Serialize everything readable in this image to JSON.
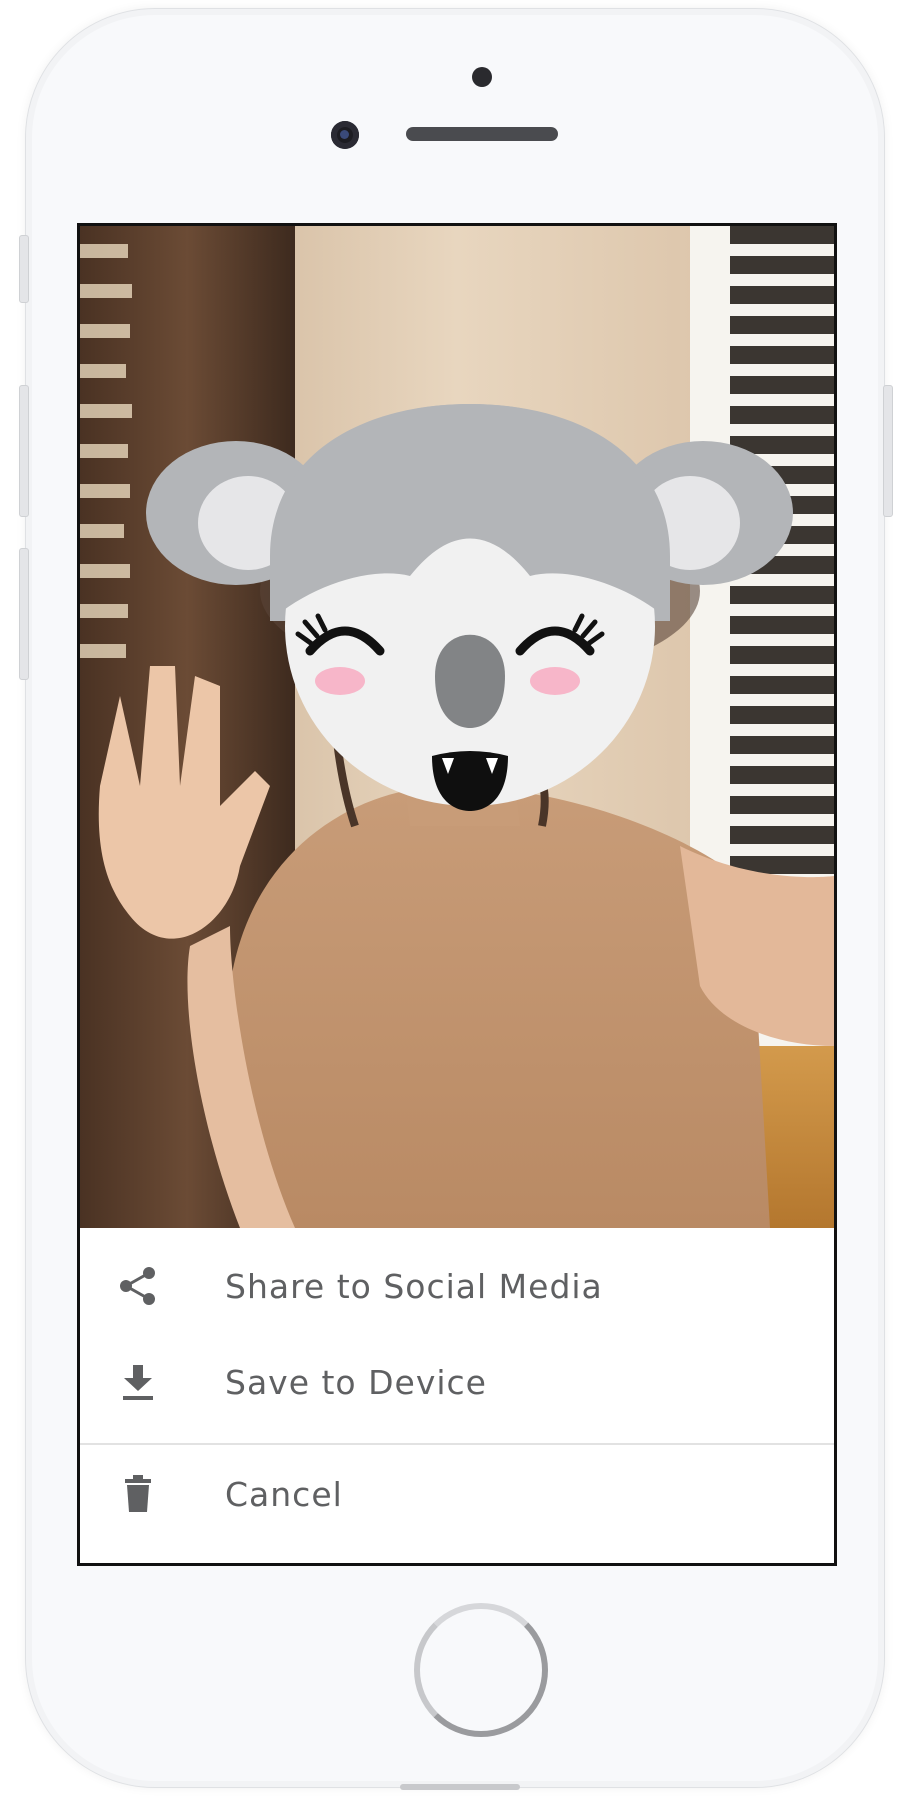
{
  "share_sheet": {
    "items": [
      {
        "label": "Share to Social Media",
        "icon": "share-icon"
      },
      {
        "label": "Save to Device",
        "icon": "download-icon"
      },
      {
        "label": "Cancel",
        "icon": "trash-icon"
      }
    ]
  },
  "colors": {
    "label_text": "#5f6062",
    "icon": "#5f6062",
    "divider": "#e2e2e2",
    "sheet_bg": "#ffffff",
    "screen_border": "#111111"
  }
}
